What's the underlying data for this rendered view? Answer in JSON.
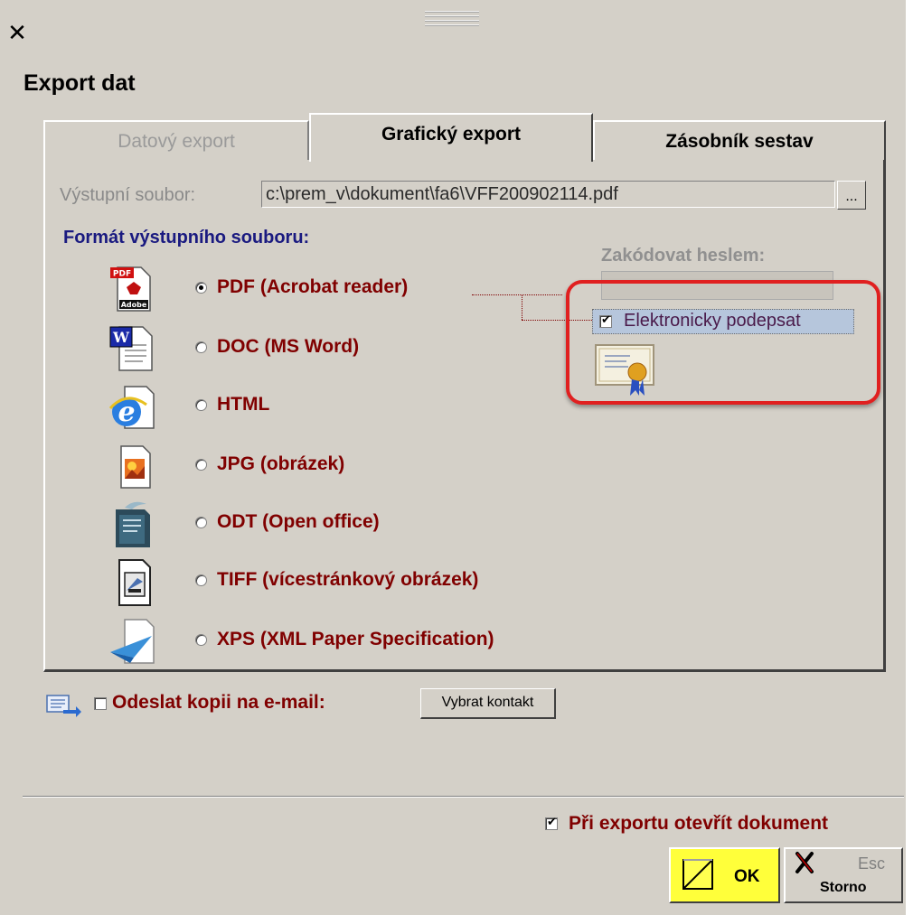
{
  "window": {
    "close_symbol": "✕",
    "title": "Export dat"
  },
  "tabs": [
    {
      "label": "Datový export",
      "active": false,
      "enabled": false
    },
    {
      "label": "Grafický export",
      "active": true,
      "enabled": true
    },
    {
      "label": "Zásobník sestav",
      "active": false,
      "enabled": true
    }
  ],
  "output_file": {
    "label": "Výstupní soubor:",
    "value": "c:\\prem_v\\dokument\\fa6\\VFF200902114.pdf",
    "browse_label": "..."
  },
  "format": {
    "heading": "Formát výstupního souboru:",
    "options": [
      {
        "label": "PDF (Acrobat reader)",
        "icon": "pdf-icon",
        "selected": true
      },
      {
        "label": "DOC (MS Word)",
        "icon": "word-icon",
        "selected": false
      },
      {
        "label": "HTML",
        "icon": "ie-icon",
        "selected": false
      },
      {
        "label": "JPG (obrázek)",
        "icon": "jpg-image-icon",
        "selected": false
      },
      {
        "label": "ODT (Open office)",
        "icon": "openoffice-icon",
        "selected": false
      },
      {
        "label": "TIFF (vícestránkový obrázek)",
        "icon": "tiff-scanner-icon",
        "selected": false
      },
      {
        "label": "XPS (XML Paper Specification)",
        "icon": "xps-icon",
        "selected": false
      }
    ]
  },
  "password": {
    "label": "Zakódovat heslem:",
    "value": ""
  },
  "signature": {
    "label": "Elektronicky podepsat",
    "checked": true,
    "icon": "certificate-icon"
  },
  "email": {
    "label": "Odeslat kopii na e-mail:",
    "checked": false,
    "contact_button": "Vybrat kontakt",
    "icon": "email-send-icon"
  },
  "open_after_export": {
    "label": "Při exportu otevřít dokument",
    "checked": true
  },
  "buttons": {
    "ok": "OK",
    "cancel": "Storno",
    "cancel_shortcut": "Esc"
  },
  "colors": {
    "dialog_bg": "#d4d0c8",
    "label_red": "#800000",
    "heading_blue": "#1a1a80",
    "highlight_frame": "#e02020",
    "ok_button": "#ffff3a"
  }
}
